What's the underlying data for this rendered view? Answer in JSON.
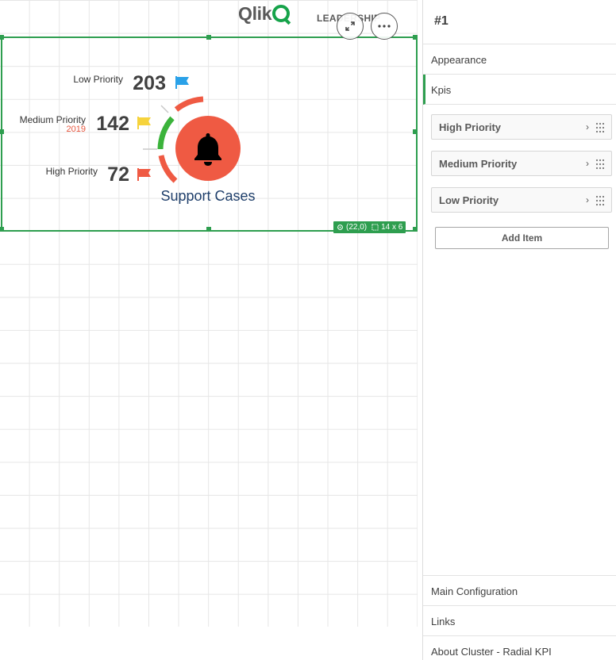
{
  "header": {
    "logo_text": "Qlik",
    "leader_text": "LEADERSHIP"
  },
  "object": {
    "position_label": "(22,0)",
    "size_label": "14 x 6",
    "expand_icon": "expand-icon",
    "more_icon": "ellipsis-icon"
  },
  "kpis": {
    "low": {
      "label": "Low Priority",
      "value": "203",
      "flag_color": "#2aa1e8"
    },
    "medium": {
      "label": "Medium Priority",
      "value": "142",
      "sub": "2019",
      "flag_color": "#f6d33c"
    },
    "high": {
      "label": "High Priority",
      "value": "72",
      "flag_color": "#ef5a43"
    }
  },
  "radial": {
    "title": "Support Cases",
    "center_icon": "bell-icon",
    "center_color": "#ef5a43",
    "arc_colors": {
      "red": "#ef5a43",
      "green": "#3bb33b"
    }
  },
  "panel": {
    "title": "#1",
    "sections": {
      "appearance": "Appearance",
      "kpis": "Kpis"
    },
    "kpi_items": [
      {
        "label": "High Priority"
      },
      {
        "label": "Medium Priority"
      },
      {
        "label": "Low Priority"
      }
    ],
    "add_item": "Add Item",
    "bottom_sections": {
      "main_configuration": "Main Configuration",
      "links": "Links",
      "about": "About Cluster - Radial KPI"
    }
  },
  "colors": {
    "accent_green": "#2e9e4f"
  }
}
